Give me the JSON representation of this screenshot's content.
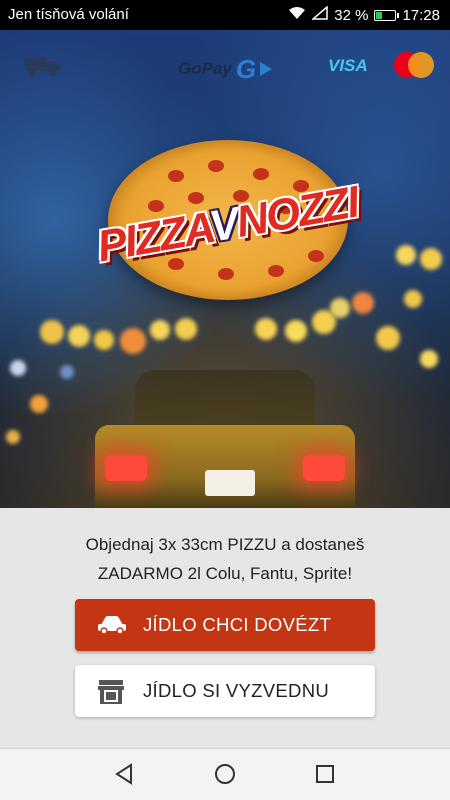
{
  "status_bar": {
    "carrier": "Jen tísňová volání",
    "battery_percent": "32 %",
    "battery_level": 0.32,
    "time": "17:28",
    "icons": [
      "wifi-icon",
      "signal-icon",
      "battery-icon"
    ]
  },
  "hero": {
    "icons": [
      "delivery-truck-icon",
      "gopay-logo",
      "visa-logo",
      "mastercard-logo"
    ],
    "gopay_text": "GoPay",
    "gopay_mark": "G",
    "visa_text": "VISA",
    "logo": {
      "part1": "PIZZA",
      "part2": "V",
      "part3": "NOZZI"
    }
  },
  "promo": {
    "line1": "Objednaj 3x 33cm PIZZU a dostaneš",
    "line2": "ZADARMO 2l Colu, Fantu, Sprite!"
  },
  "buttons": {
    "delivery": {
      "label": "JÍDLO CHCI DOVÉZT",
      "icon": "car-icon",
      "color": "#c43514"
    },
    "pickup": {
      "label": "JÍDLO SI VYZVEDNU",
      "icon": "shop-icon",
      "color": "#ffffff"
    }
  },
  "navbar": {
    "icons": [
      "back-icon",
      "home-icon",
      "recents-icon"
    ]
  },
  "colors": {
    "accent": "#c43514",
    "panel_bg": "#e6e6e6"
  }
}
